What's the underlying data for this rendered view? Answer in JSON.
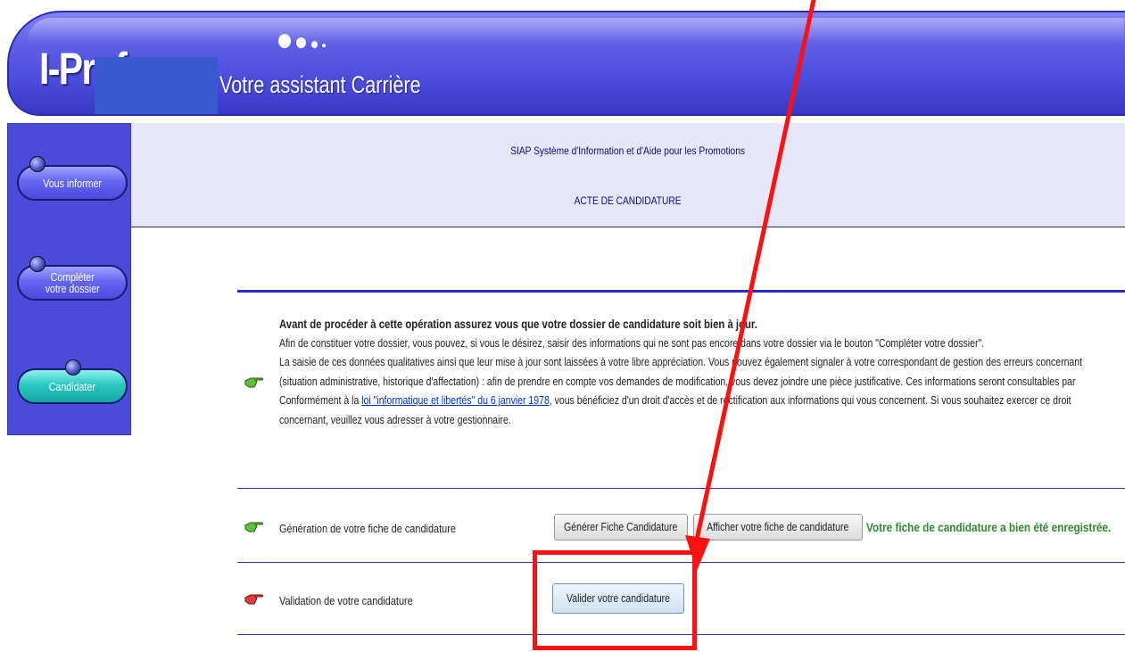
{
  "header": {
    "logo": "I-Prof",
    "subtitle": "Votre assistant Carrière"
  },
  "sidebar": {
    "items": [
      {
        "label": "Vous informer"
      },
      {
        "label_line1": "Compléter",
        "label_line2": "votre dossier"
      },
      {
        "label": "Candidater"
      }
    ]
  },
  "banner": {
    "title": "SIAP Système d'Information et d'Aide pour les Promotions",
    "subtitle": "ACTE DE CANDIDATURE"
  },
  "intro": {
    "heading": "Avant de procéder à cette opération assurez vous que votre dossier de candidature soit bien à jour.",
    "line1": "Afin de constituer votre dossier, vous pouvez, si vous le désirez, saisir des informations qui ne sont pas encore dans votre dossier via le bouton \"Compléter votre dossier\".",
    "line2": "La saisie de ces données qualitatives ainsi que leur mise à jour sont laissées à votre libre appréciation. Vous pouvez également signaler à votre correspondant de gestion des erreurs concernant",
    "line3": "(situation administrative, historique d'affectation) : afin de prendre en compte vos demandes de modification, vous devez joindre une pièce justificative. Ces informations seront consultables par",
    "line4_prefix": "Conformément à la ",
    "line4_link": "loi \"informatique et libertés\" du 6 janvier 1978",
    "line4_suffix": ", vous bénéficiez d'un droit d'accès et de rectification aux informations qui vous concernent. Si vous souhaitez exercer ce droit",
    "line5": "concernant, veuillez vous adresser à votre gestionnaire."
  },
  "generation": {
    "label": "Génération de votre fiche de candidature",
    "generate_button": "Générer Fiche Candidature",
    "show_button": "Afficher votre fiche de candidature",
    "status": "Votre fiche de candidature a bien été enregistrée."
  },
  "validation": {
    "label": "Validation de votre candidature",
    "button": "Valider votre candidature"
  },
  "colors": {
    "header": "#4a4adb",
    "banner": "#e6e6f9",
    "status": "#2f8a2f",
    "annotation": "#ff1010"
  }
}
